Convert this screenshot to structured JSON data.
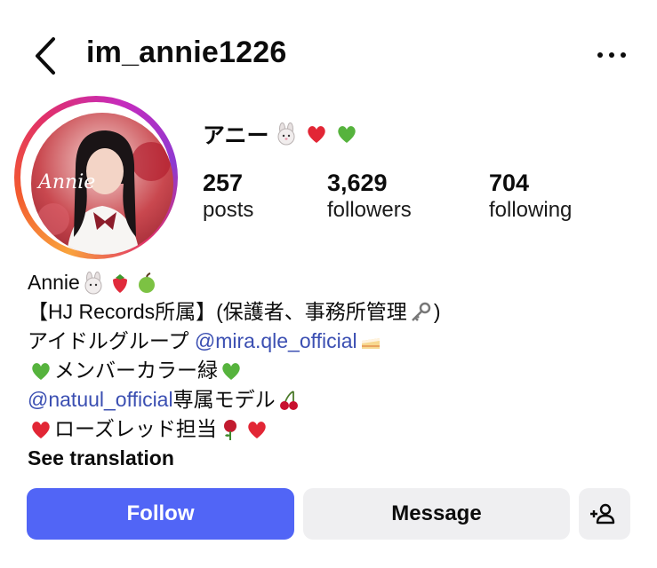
{
  "header": {
    "username": "im_annie1226",
    "back_icon": "chevron-left-icon",
    "more_icon": "more-horizontal-icon"
  },
  "profile": {
    "display_name": "アニー",
    "display_name_emojis": [
      "rabbit-face-icon",
      "red-heart-icon",
      "green-heart-icon"
    ],
    "avatar_text": "Annie",
    "ring_colors": [
      "#f9a33c",
      "#e0306b",
      "#c52bbd"
    ],
    "stats": [
      {
        "value": "257",
        "label": "posts"
      },
      {
        "value": "3,629",
        "label": "followers"
      },
      {
        "value": "704",
        "label": "following"
      }
    ]
  },
  "bio": {
    "line1": "Annie",
    "line2": "【HJ Records所属】(保護者、事務所管理",
    "line2_end": ")",
    "line3_prefix": "アイドルグループ ",
    "line3_mention": "@mira.qle_official",
    "line4": "メンバーカラー緑",
    "line5_mention": "@natuul_official",
    "line5_text": " 専属モデル",
    "line6": "ローズレッド担当",
    "see_translation": "See translation"
  },
  "actions": {
    "follow": "Follow",
    "message": "Message",
    "add_user_icon": "add-person-icon"
  },
  "colors": {
    "follow_bg": "#5165f6",
    "secondary_bg": "#efeff1",
    "mention": "#3b4fb2"
  }
}
